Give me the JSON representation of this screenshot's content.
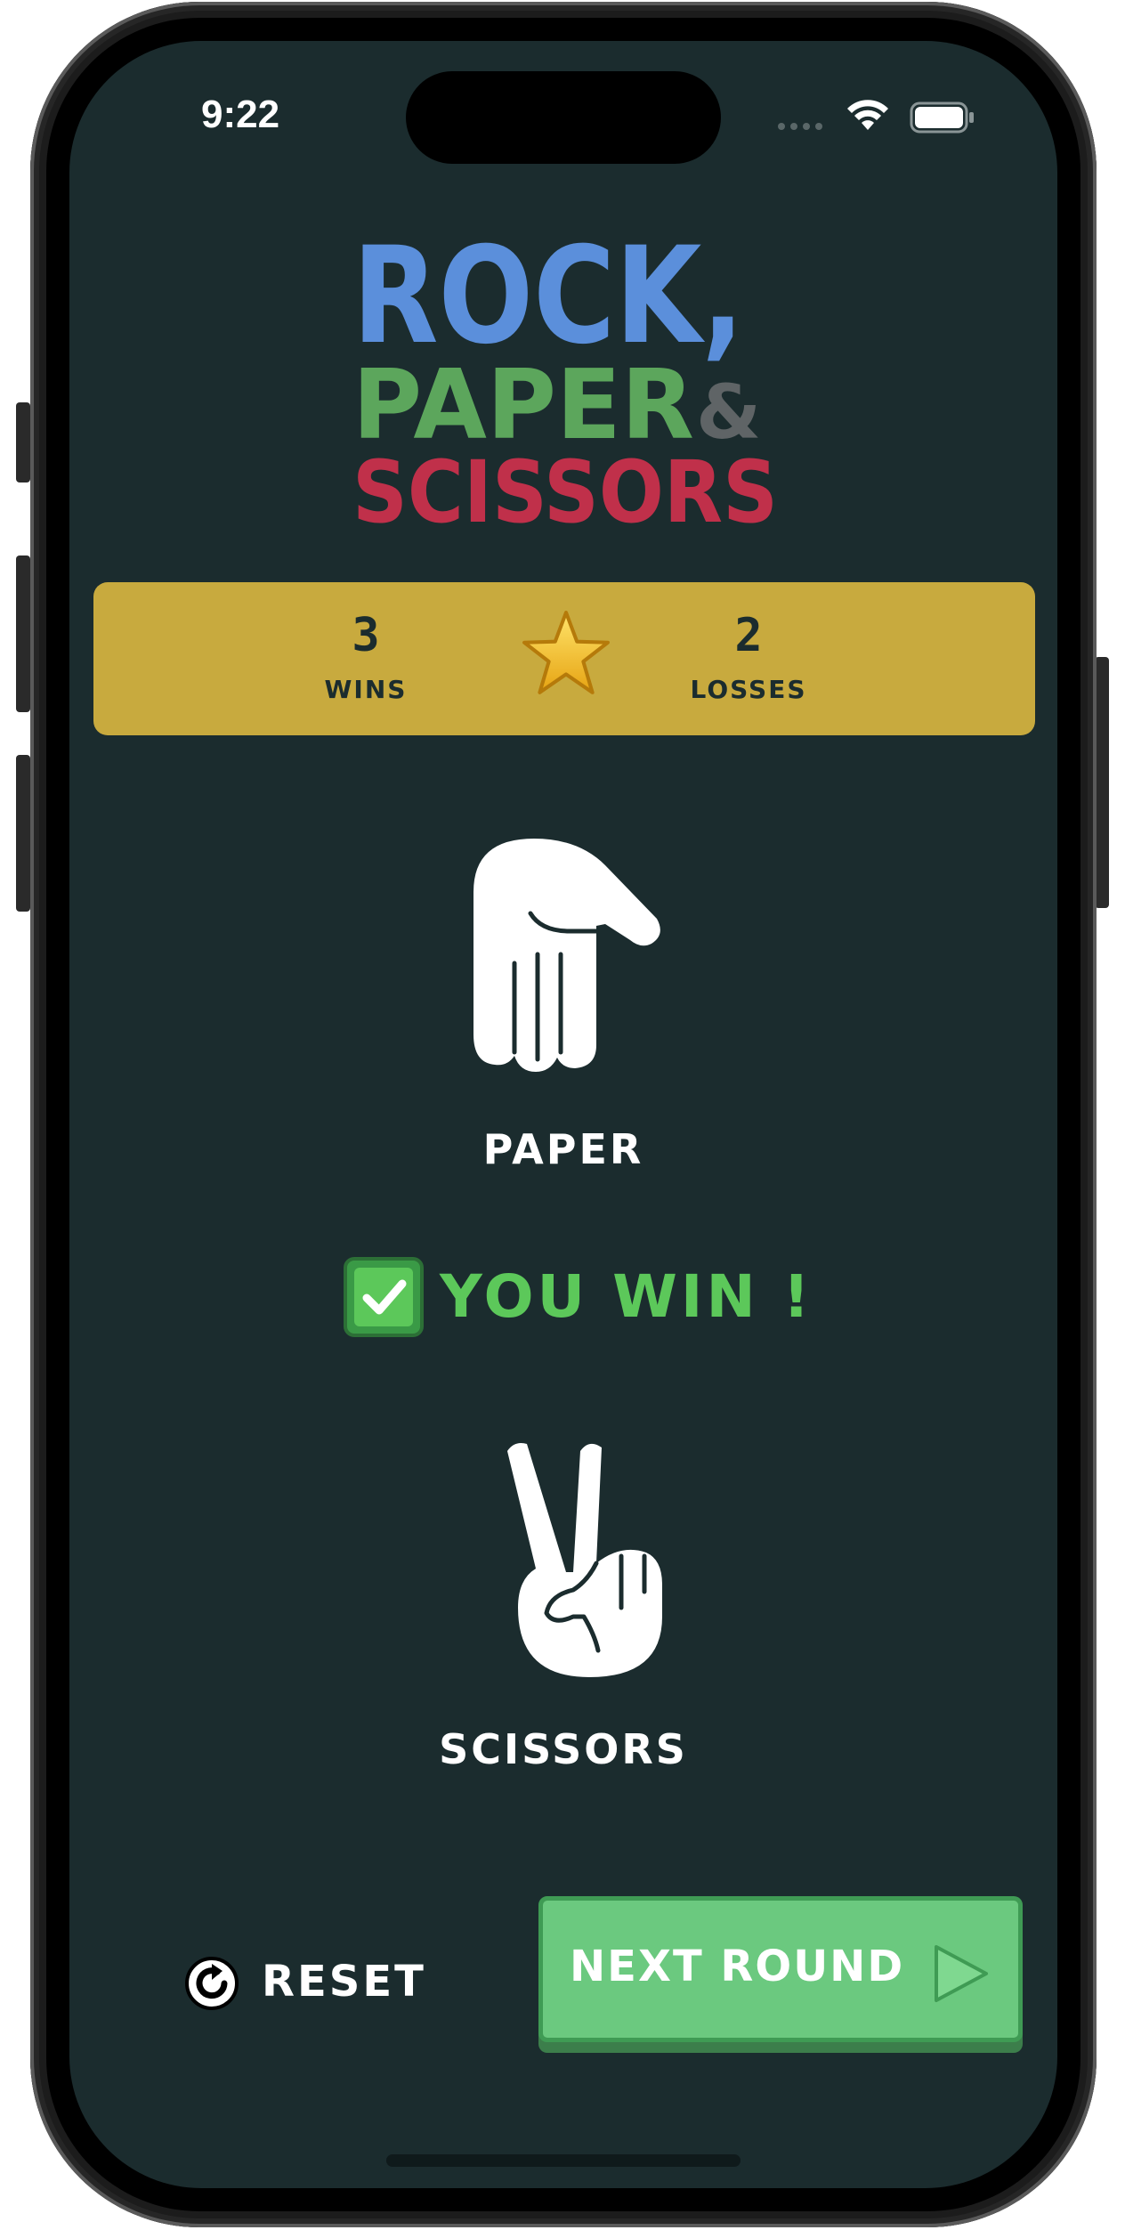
{
  "status_bar": {
    "time": "9:22"
  },
  "logo": {
    "line1": "ROCK,",
    "line2": "PAPER",
    "amp": "&",
    "line3": "SCISSORS"
  },
  "score": {
    "wins": "3",
    "wins_label": "WINS",
    "losses": "2",
    "losses_label": "LOSSES"
  },
  "player": {
    "choice": "PAPER",
    "icon": "paper-hand-icon"
  },
  "result": {
    "text": "YOU WIN !"
  },
  "opponent": {
    "choice": "SCISSORS",
    "icon": "scissors-hand-icon"
  },
  "controls": {
    "reset_label": "RESET",
    "next_label": "NEXT ROUND"
  },
  "colors": {
    "background": "#1b2c2e",
    "rock": "#5b8fdb",
    "paper": "#5ca65c",
    "scissors": "#c0304a",
    "score_panel": "#c8aa3e",
    "win": "#5cc85a",
    "button": "#6bc97f"
  }
}
